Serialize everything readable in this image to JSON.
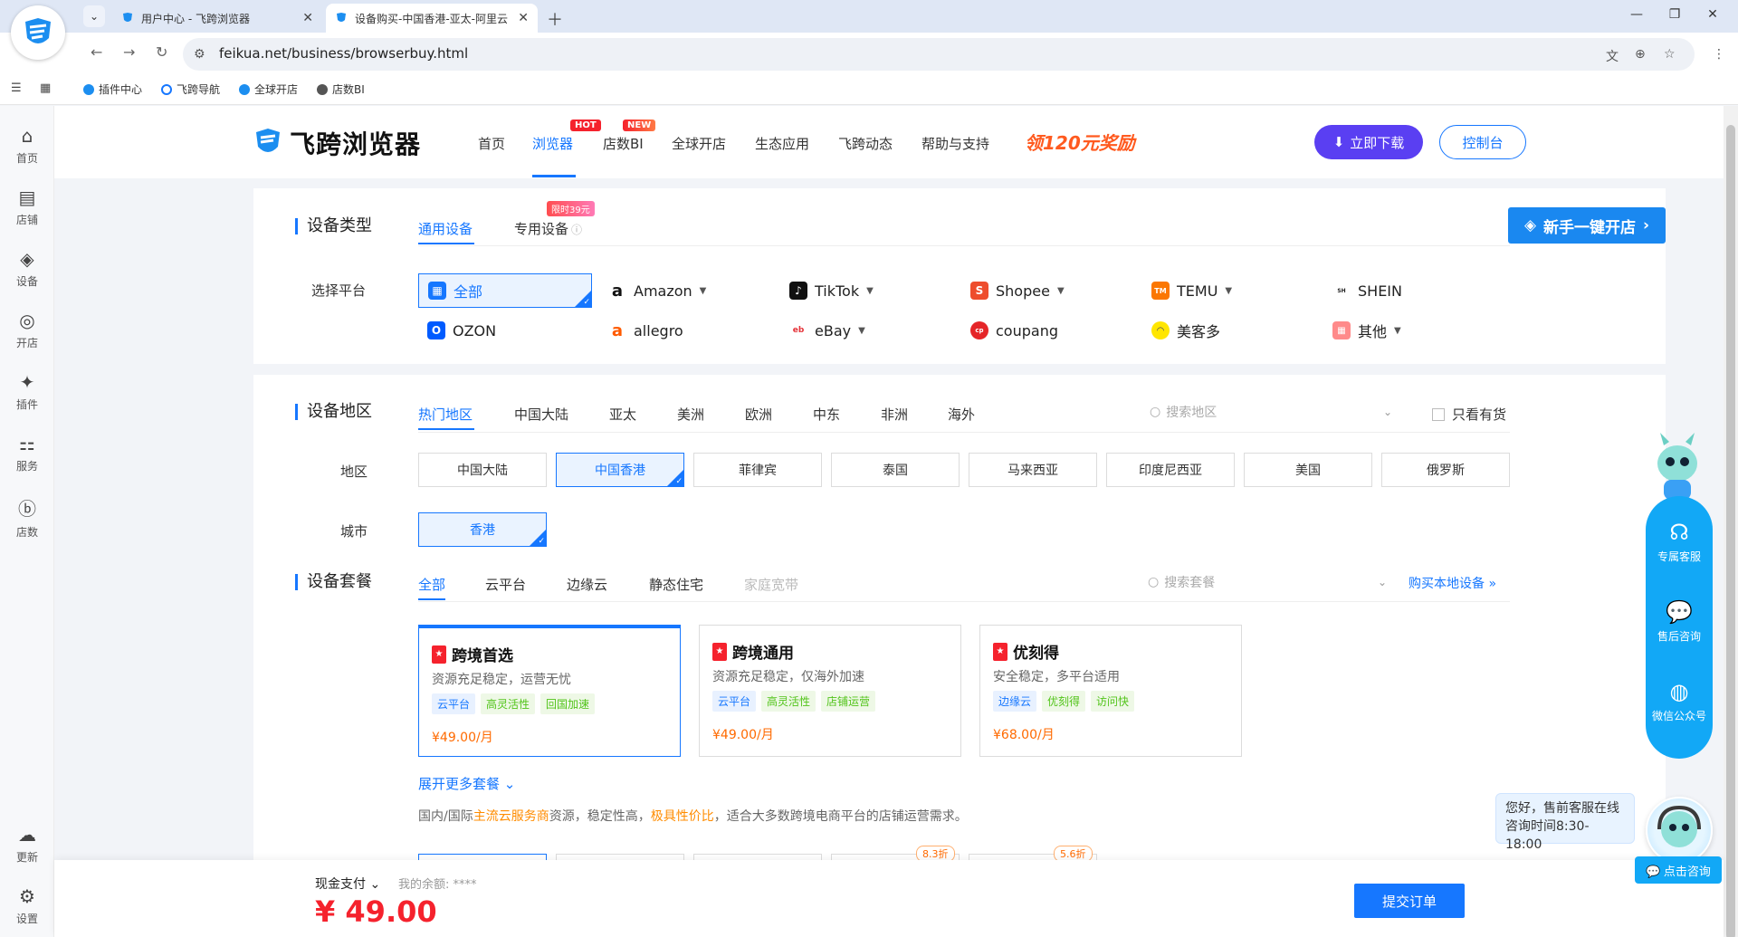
{
  "tabs": [
    {
      "title": "用户中心 - 飞跨浏览器"
    },
    {
      "title": "设备购买-中国香港-亚太-阿里云"
    }
  ],
  "address": {
    "url": "feikua.net/business/browserbuy.html"
  },
  "bookmarks": [
    "插件中心",
    "飞跨导航",
    "全球开店",
    "店数BI"
  ],
  "rail": [
    "首页",
    "店铺",
    "设备",
    "开店",
    "插件",
    "服务",
    "店数",
    "更新",
    "设置"
  ],
  "header": {
    "brand": "飞跨浏览器",
    "nav": [
      "首页",
      "浏览器",
      "店数BI",
      "全球开店",
      "生态应用",
      "飞跨动态",
      "帮助与支持"
    ],
    "hot_badge": "HOT",
    "new_badge": "NEW",
    "promo": "领120元奖励",
    "download": "立即下载",
    "console": "控制台"
  },
  "device_type": {
    "title": "设备类型",
    "tabs": [
      "通用设备",
      "专用设备"
    ],
    "limited_badge": "限时39元",
    "newbie": "新手一键开店",
    "platform_label": "选择平台",
    "platforms": [
      {
        "name": "全部",
        "icon": "grid-icon",
        "color": "#1677ff"
      },
      {
        "name": "Amazon",
        "icon": "amazon-icon",
        "color": "#111111"
      },
      {
        "name": "TikTok",
        "icon": "tiktok-icon",
        "color": "#111111"
      },
      {
        "name": "Shopee",
        "icon": "shopee-icon",
        "color": "#ee4d2d"
      },
      {
        "name": "TEMU",
        "icon": "temu-icon",
        "color": "#fb7701"
      },
      {
        "name": "SHEIN",
        "icon": "shein-icon",
        "color": "#222222"
      },
      {
        "name": "OZON",
        "icon": "ozon-icon",
        "color": "#005bff"
      },
      {
        "name": "allegro",
        "icon": "allegro-icon",
        "color": "#ff5a00"
      },
      {
        "name": "eBay",
        "icon": "ebay-icon",
        "color": "#e53238"
      },
      {
        "name": "coupang",
        "icon": "coupang-icon",
        "color": "#e52528"
      },
      {
        "name": "美客多",
        "icon": "mercadolibre-icon",
        "color": "#ffe600"
      },
      {
        "name": "其他",
        "icon": "other-icon",
        "color": "#ff8a8a"
      }
    ]
  },
  "region": {
    "title": "设备地区",
    "tabs": [
      "热门地区",
      "中国大陆",
      "亚太",
      "美洲",
      "欧洲",
      "中东",
      "非洲",
      "海外"
    ],
    "search_placeholder": "搜索地区",
    "only_stock": "只看有货",
    "area_label": "地区",
    "areas": [
      "中国大陆",
      "中国香港",
      "菲律宾",
      "泰国",
      "马来西亚",
      "印度尼西亚",
      "美国",
      "俄罗斯"
    ],
    "city_label": "城市",
    "cities": [
      "香港"
    ]
  },
  "package": {
    "title": "设备套餐",
    "tabs": [
      "全部",
      "云平台",
      "边缘云",
      "静态住宅",
      "家庭宽带"
    ],
    "search_placeholder": "搜索套餐",
    "local_link": "购买本地设备 »",
    "items": [
      {
        "name": "跨境首选",
        "desc": "资源充足稳定，运营无忧",
        "tags": [
          "云平台",
          "高灵活性",
          "回国加速"
        ],
        "price": "¥49.00/月"
      },
      {
        "name": "跨境通用",
        "desc": "资源充足稳定，仅海外加速",
        "tags": [
          "云平台",
          "高灵活性",
          "店铺运营"
        ],
        "price": "¥49.00/月"
      },
      {
        "name": "优刻得",
        "desc": "安全稳定，多平台适用",
        "tags": [
          "边缘云",
          "优刻得",
          "访问快"
        ],
        "price": "¥68.00/月"
      }
    ],
    "expand": "展开更多套餐",
    "desc_parts": [
      "国内/国际",
      "主流云服务商",
      "资源，稳定性高，",
      "极具性价比",
      "，适合大多数跨境电商平台的店铺运营需求。"
    ],
    "discounts": [
      "8.3折",
      "5.6折"
    ]
  },
  "bottom": {
    "pay_method": "现金支付",
    "balance": "我的余额: ****",
    "total": "¥ 49.00",
    "submit": "提交订单"
  },
  "float": {
    "items": [
      "专属客服",
      "售后咨询",
      "微信公众号"
    ],
    "bubble_1": "您好，售前客服在线",
    "bubble_2": "咨询时间8:30-18:00",
    "consult": "点击咨询"
  }
}
